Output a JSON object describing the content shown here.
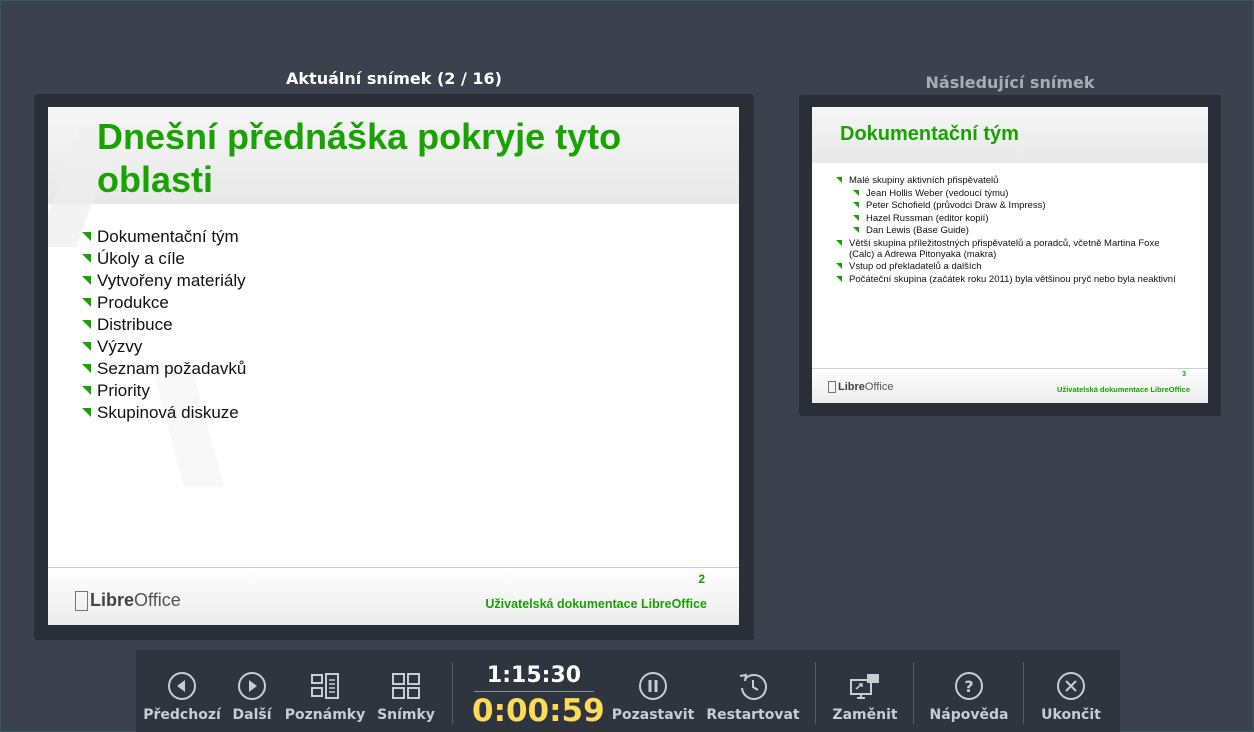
{
  "labels": {
    "current": "Aktuální snímek (2 / 16)",
    "next": "Následující snímek"
  },
  "current_slide": {
    "title": "Dnešní přednáška pokryje tyto oblasti",
    "bullets": [
      "Dokumentační tým",
      "Úkoly a cíle",
      "Vytvořeny materiály",
      "Produkce",
      "Distribuce",
      "Výzvy",
      "Seznam požadavků",
      "Priority",
      "Skupinová diskuze"
    ],
    "number": "2",
    "footer": "Uživatelská dokumentace LibreOffice",
    "logo_main": "Libre",
    "logo_rest": "Office"
  },
  "next_slide": {
    "title": "Dokumentační tým",
    "bullets": [
      {
        "text": "Malé skupiny aktivních přispěvatelů",
        "level": 1
      },
      {
        "text": "Jean Hollis Weber (vedoucí týmu)",
        "level": 2
      },
      {
        "text": "Peter Schofield (průvodci Draw & Impress)",
        "level": 2
      },
      {
        "text": "Hazel Russman (editor kopií)",
        "level": 2
      },
      {
        "text": "Dan Lewis (Base Guide)",
        "level": 2
      },
      {
        "text": "Větší skupina příležitostných přispěvatelů a poradců, včetně Martina Foxe (Calc) a Adrewa Pitonyaka (makra)",
        "level": 1
      },
      {
        "text": "Vstup od překladatelů a dalších",
        "level": 1
      },
      {
        "text": "Počáteční skupina (začátek roku 2011) byla většinou pryč nebo byla neaktivní",
        "level": 1
      }
    ],
    "number": "3",
    "footer": "Uživatelská dokumentace LibreOffice",
    "logo_main": "Libre",
    "logo_rest": "Office"
  },
  "toolbar": {
    "prev": "Předchozí",
    "next": "Další",
    "notes": "Poznámky",
    "slides": "Snímky",
    "clock": "1:15:30",
    "elapsed": "0:00:59",
    "pause": "Pozastavit",
    "restart": "Restartovat",
    "swap": "Zaměnit",
    "help": "Nápověda",
    "exit": "Ukončit"
  },
  "colors": {
    "background": "#3c424d",
    "accent_green": "#18a303",
    "timer_yellow": "#ffdb55"
  }
}
